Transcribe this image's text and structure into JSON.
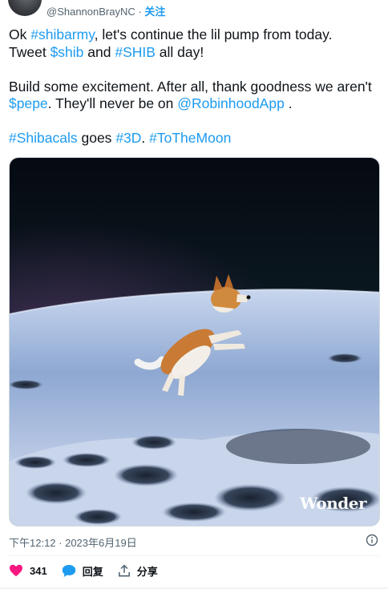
{
  "author": {
    "handle": "@ShannonBrayNC",
    "separator": " · ",
    "follow_label": "关注"
  },
  "tweet": {
    "line1": {
      "pre": "Ok ",
      "tag1": "#shibarmy",
      "post": ", let's continue the lil pump from today."
    },
    "line2": {
      "pre": "Tweet ",
      "tag1": "$shib",
      "mid": " and ",
      "tag2": "#SHIB",
      "post": " all day!"
    },
    "line3": {
      "text": "Build some excitement. After all, thank goodness we aren't"
    },
    "line4": {
      "tag1": "$pepe",
      "mid": ". They'll never be on ",
      "tag2": "@RobinhoodApp",
      "post": " ."
    },
    "line5": {
      "tag1": "#Shibacals",
      "mid1": " goes ",
      "tag2": "#3D",
      "mid2": ". ",
      "tag3": "#ToTheMoon"
    }
  },
  "media": {
    "watermark": "Wonder"
  },
  "meta": {
    "timestamp": "下午12:12 · 2023年6月19日"
  },
  "actions": {
    "likes_count": "341",
    "reply_label": "回复",
    "share_label": "分享"
  },
  "colors": {
    "accent": "#1d9bf0",
    "like": "#f91880",
    "text": "#0f1419",
    "muted": "#536471"
  }
}
